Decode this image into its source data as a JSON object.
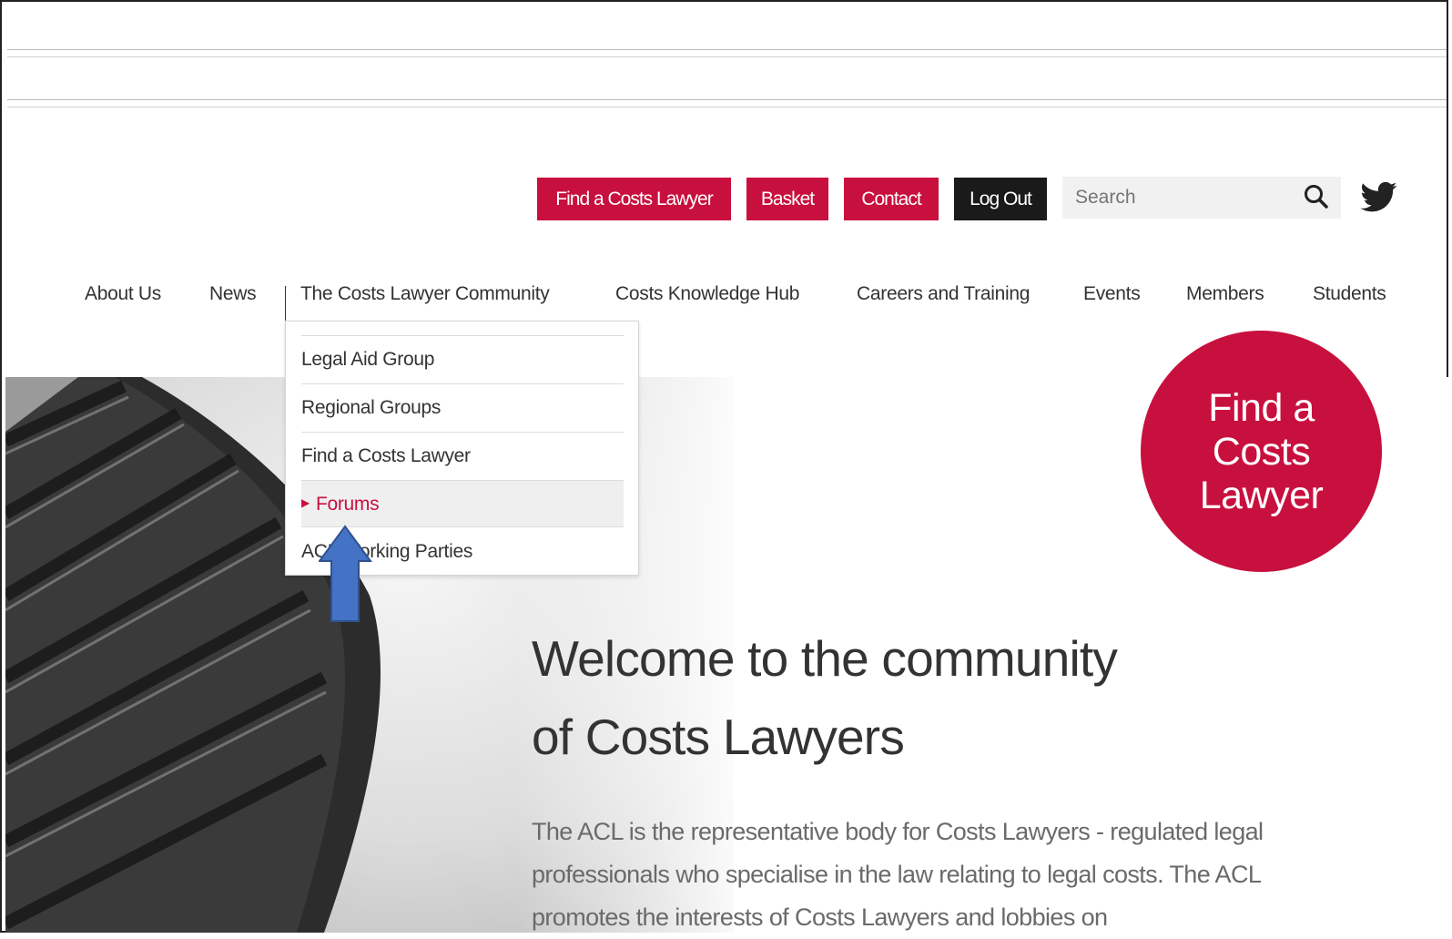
{
  "utility_bar": {
    "find_lawyer_label": "Find a Costs Lawyer",
    "basket_label": "Basket",
    "contact_label": "Contact",
    "logout_label": "Log Out",
    "search_placeholder": "Search"
  },
  "main_nav": {
    "items": [
      {
        "label": "About Us"
      },
      {
        "label": "News"
      },
      {
        "label": "The Costs Lawyer Community"
      },
      {
        "label": "Costs Knowledge Hub"
      },
      {
        "label": "Careers and Training"
      },
      {
        "label": "Events"
      },
      {
        "label": "Members"
      },
      {
        "label": "Students"
      }
    ]
  },
  "dropdown": {
    "items": [
      {
        "label": "Legal Aid Group"
      },
      {
        "label": "Regional Groups"
      },
      {
        "label": "Find a Costs Lawyer"
      },
      {
        "label": "Forums"
      },
      {
        "label": "ACL Working Parties"
      }
    ]
  },
  "hero": {
    "circle_label": "Find a Costs Lawyer",
    "welcome_line1": "Welcome to the community",
    "welcome_line2": "of Costs Lawyers",
    "intro_text": "The ACL is the representative body for Costs Lawyers - regulated legal professionals who specialise in the law relating to legal costs. The ACL promotes the interests of Costs Lawyers and lobbies on"
  },
  "colors": {
    "brand_red": "#c8103e",
    "dark_button": "#1a1a1a",
    "annotation_arrow": "#4472c4"
  },
  "icons": {
    "search": "search-icon",
    "twitter": "twitter-icon",
    "arrow": "up-arrow-annotation"
  }
}
